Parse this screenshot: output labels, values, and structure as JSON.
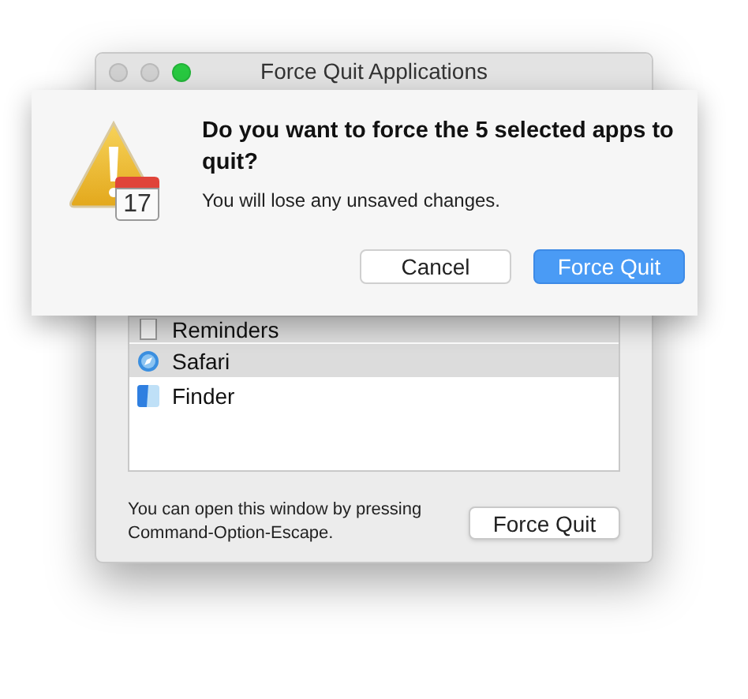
{
  "window": {
    "title": "Force Quit Applications",
    "traffic_lights": [
      {
        "kind": "close",
        "enabled": false
      },
      {
        "kind": "minimize",
        "enabled": false
      },
      {
        "kind": "zoom",
        "enabled": true
      }
    ]
  },
  "apps": [
    {
      "name": "Reminders",
      "kind": "notes",
      "selected": true
    },
    {
      "name": "Safari",
      "kind": "compass",
      "selected": true
    },
    {
      "name": "Finder",
      "kind": "finder",
      "selected": false
    }
  ],
  "footer": {
    "hint": "You can open this window by pressing Command-Option-Escape.",
    "button": "Force Quit"
  },
  "alert": {
    "calendar_day": "17",
    "title": "Do you want to force the 5 selected apps to quit?",
    "message": "You will lose any unsaved changes.",
    "buttons": [
      {
        "label": "Cancel",
        "default": false
      },
      {
        "label": "Force Quit",
        "default": true
      }
    ]
  }
}
